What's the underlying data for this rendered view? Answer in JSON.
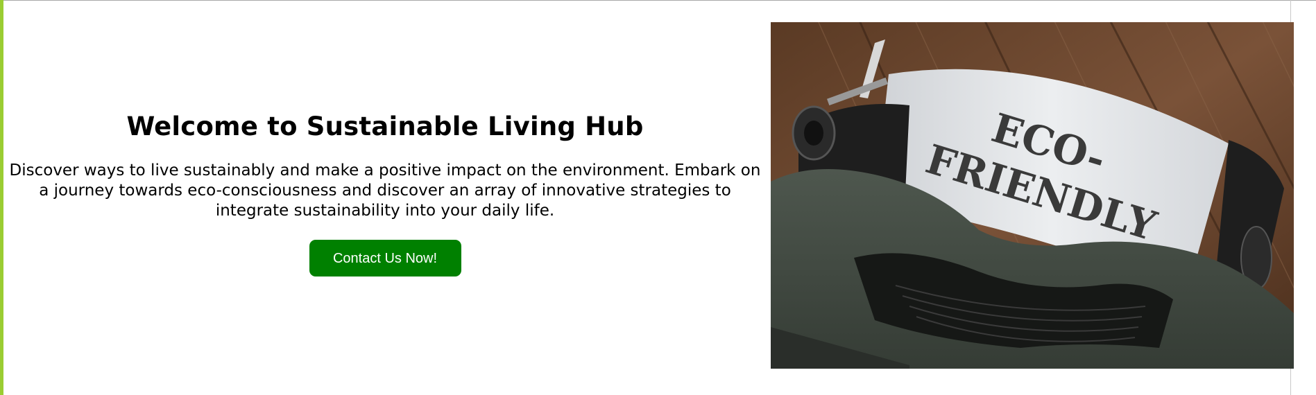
{
  "hero": {
    "title": "Welcome to Sustainable Living Hub",
    "description": "Discover ways to live sustainably and make a positive impact on the environment. Embark on a journey towards eco-consciousness and discover an array of innovative strategies to integrate sustainability into your daily life.",
    "cta_label": "Contact Us Now!",
    "image": {
      "paper_line1": "ECO-",
      "paper_line2": "FRIENDLY",
      "subject": "typewriter-photo"
    }
  },
  "colors": {
    "accent_bar": "#9acd32",
    "button_bg": "#008000",
    "button_text": "#ffffff",
    "text": "#000000",
    "background": "#ffffff"
  }
}
